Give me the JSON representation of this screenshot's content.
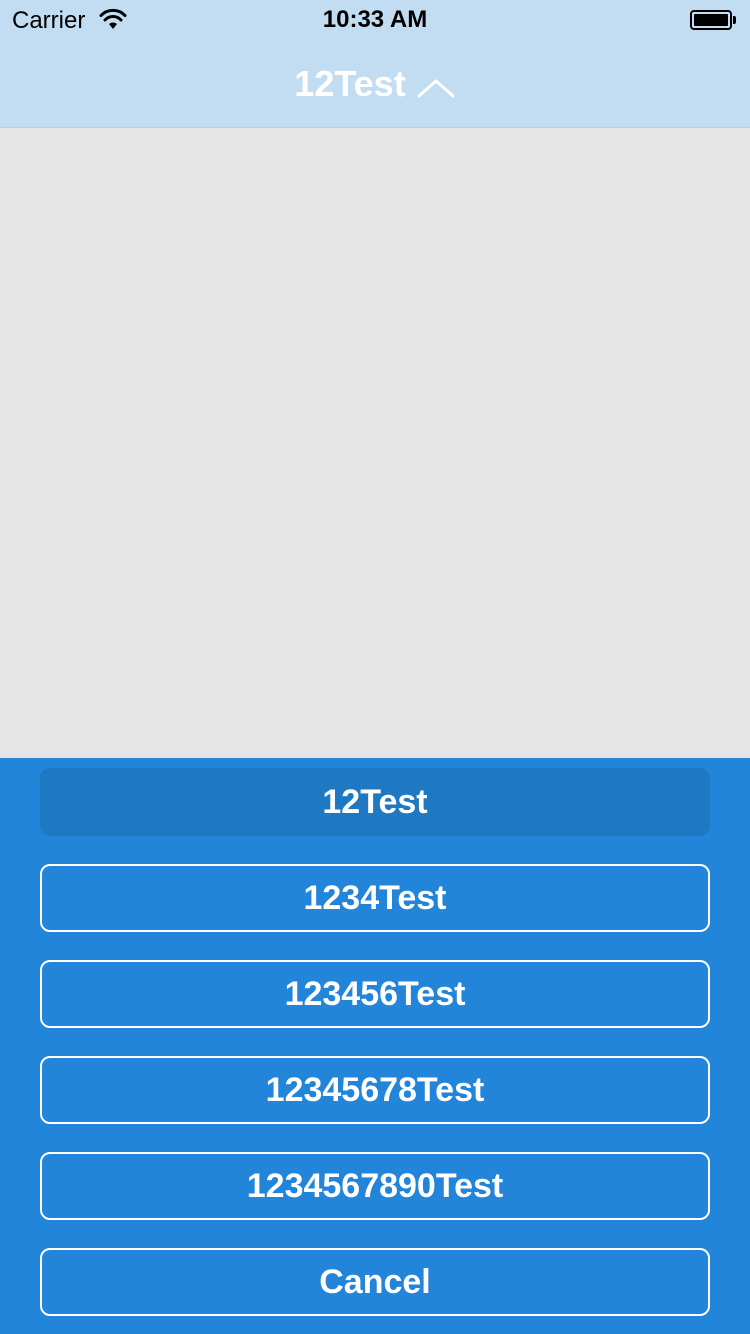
{
  "status_bar": {
    "carrier": "Carrier",
    "time": "10:33 AM",
    "wifi_icon": "wifi-icon",
    "battery_icon": "battery-icon"
  },
  "nav": {
    "title": "12Test",
    "toggle_icon": "chevron-up-icon"
  },
  "colors": {
    "nav_background": "#c2ddf2",
    "content_background": "#e5e5e5",
    "panel_background": "#2285da",
    "selected_option_background": "#1f78c2",
    "option_text": "#ffffff"
  },
  "options": [
    {
      "label": "12Test",
      "selected": true
    },
    {
      "label": "1234Test",
      "selected": false
    },
    {
      "label": "123456Test",
      "selected": false
    },
    {
      "label": "12345678Test",
      "selected": false
    },
    {
      "label": "1234567890Test",
      "selected": false
    }
  ],
  "cancel_label": "Cancel"
}
